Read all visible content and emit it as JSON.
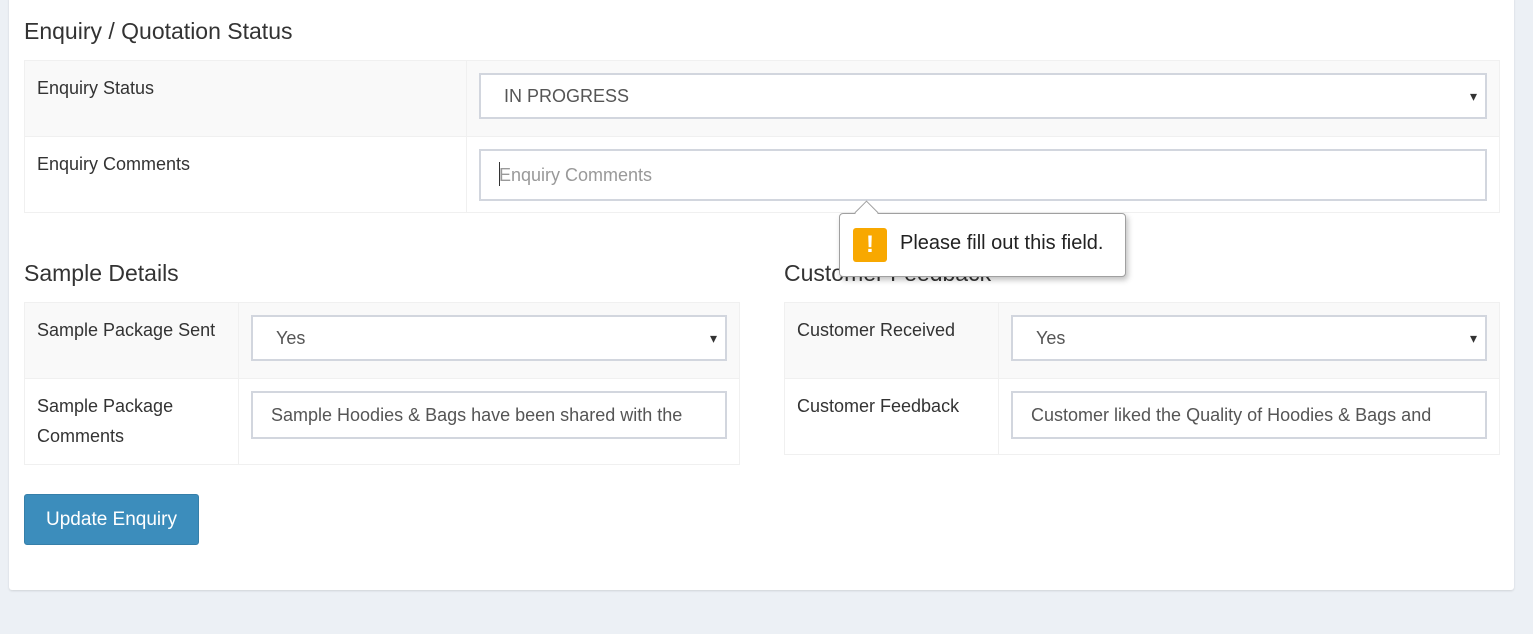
{
  "enquiry_section": {
    "title": "Enquiry / Quotation Status",
    "status_label": "Enquiry Status",
    "status_value": "IN PROGRESS",
    "comments_label": "Enquiry Comments",
    "comments_placeholder": "Enquiry Comments",
    "comments_value": ""
  },
  "sample_section": {
    "title": "Sample Details",
    "sent_label": "Sample Package Sent",
    "sent_value": "Yes",
    "comments_label": "Sample Package Comments",
    "comments_value": "Sample Hoodies & Bags have been shared with the"
  },
  "feedback_section": {
    "title": "Customer Feedback",
    "received_label": "Customer Received",
    "received_value": "Yes",
    "feedback_label": "Customer Feedback",
    "feedback_value": "Customer liked the Quality of Hoodies & Bags and"
  },
  "validation_tooltip": {
    "icon": "warning-icon",
    "icon_glyph": "!",
    "message": "Please fill out this field.",
    "icon_color": "#f8a800"
  },
  "actions": {
    "update_label": "Update Enquiry"
  },
  "colors": {
    "primary": "#3c8dbc",
    "background": "#ecf0f5"
  },
  "glyphs": {
    "caret": "▾"
  }
}
